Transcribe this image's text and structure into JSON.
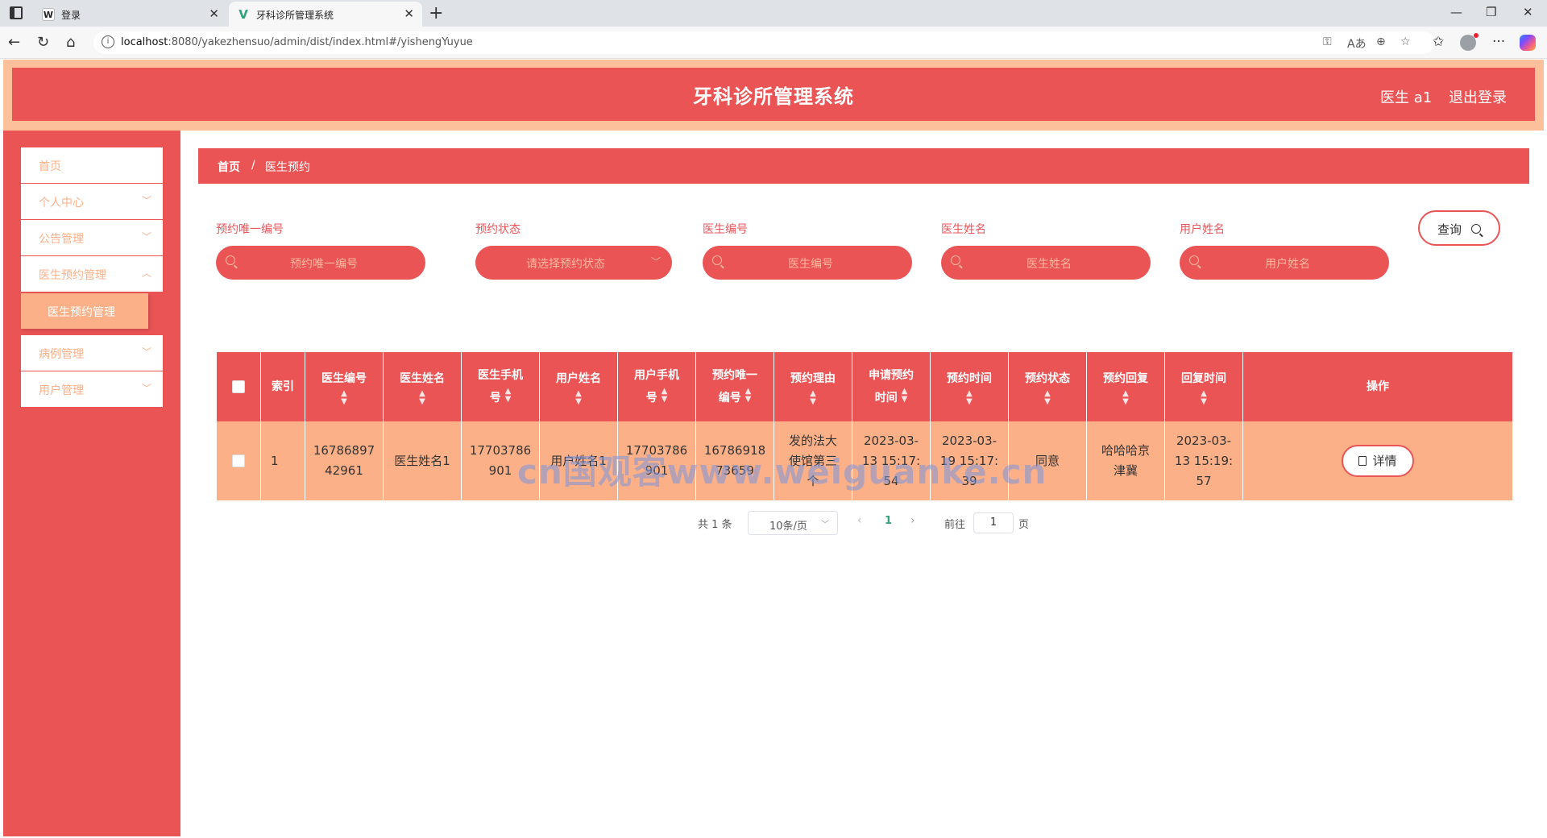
{
  "browser": {
    "tabs": [
      {
        "label": "登录",
        "favicon": "W"
      },
      {
        "label": "牙科诊所管理系统",
        "favicon": "V"
      }
    ],
    "url_host": "localhost",
    "url_path": ":8080/yakezhensuo/admin/dist/index.html#/yishengYuyue"
  },
  "header": {
    "title": "牙科诊所管理系统",
    "user": "医生 a1",
    "logout": "退出登录"
  },
  "sidebar": {
    "items": [
      {
        "label": "首页",
        "has_chevron": false
      },
      {
        "label": "个人中心",
        "has_chevron": true
      },
      {
        "label": "公告管理",
        "has_chevron": true
      },
      {
        "label": "医生预约管理",
        "has_chevron": true
      },
      {
        "label": "病例管理",
        "has_chevron": true
      },
      {
        "label": "用户管理",
        "has_chevron": true
      }
    ],
    "submenu_active": "医生预约管理"
  },
  "breadcrumb": {
    "home": "首页",
    "separator": "/",
    "current": "医生预约"
  },
  "filters": [
    {
      "label": "预约唯一编号",
      "placeholder": "预约唯一编号",
      "type": "input"
    },
    {
      "label": "预约状态",
      "placeholder": "请选择预约状态",
      "type": "select"
    },
    {
      "label": "医生编号",
      "placeholder": "医生编号",
      "type": "input"
    },
    {
      "label": "医生姓名",
      "placeholder": "医生姓名",
      "type": "input"
    },
    {
      "label": "用户姓名",
      "placeholder": "用户姓名",
      "type": "input"
    }
  ],
  "query_button": "查询",
  "table": {
    "headers": {
      "index": "索引",
      "col1": [
        "医生编号"
      ],
      "col2": [
        "医生姓名"
      ],
      "col3": [
        "医生手机",
        "号"
      ],
      "col4": [
        "用户姓名"
      ],
      "col5": [
        "用户手机",
        "号"
      ],
      "col6": [
        "预约唯一",
        "编号"
      ],
      "col7": [
        "预约理由"
      ],
      "col8": [
        "申请预约",
        "时间"
      ],
      "col9": [
        "预约时间"
      ],
      "col10": [
        "预约状态"
      ],
      "col11": [
        "预约回复"
      ],
      "col12": [
        "回复时间"
      ],
      "action": "操作"
    },
    "rows": [
      {
        "index": "1",
        "doctor_no": [
          "16786897",
          "42961"
        ],
        "doctor_name": "医生姓名1",
        "doctor_phone": [
          "17703786",
          "901"
        ],
        "user_name": "用户姓名1",
        "user_phone": [
          "17703786",
          "901"
        ],
        "appt_no": [
          "16786918",
          "73659"
        ],
        "reason": [
          "发的法大",
          "使馆第三",
          "个"
        ],
        "apply_time": [
          "2023-03-",
          "13 15:17:",
          "54"
        ],
        "appt_time": [
          "2023-03-",
          "19 15:17:",
          "39"
        ],
        "status": "同意",
        "reply": [
          "哈哈哈京",
          "津冀"
        ],
        "reply_time": [
          "2023-03-",
          "13 15:19:",
          "57"
        ],
        "action": "详情"
      }
    ]
  },
  "pagination": {
    "total": "共 1 条",
    "page_size": "10条/页",
    "current": "1",
    "goto_prefix": "前往",
    "goto_value": "1",
    "goto_suffix": "页"
  },
  "watermark": "cn国观客www.weiguanke.cn",
  "colors": {
    "primary": "#ea5455",
    "accent": "#fcb088",
    "header_border": "#fcc09a"
  }
}
